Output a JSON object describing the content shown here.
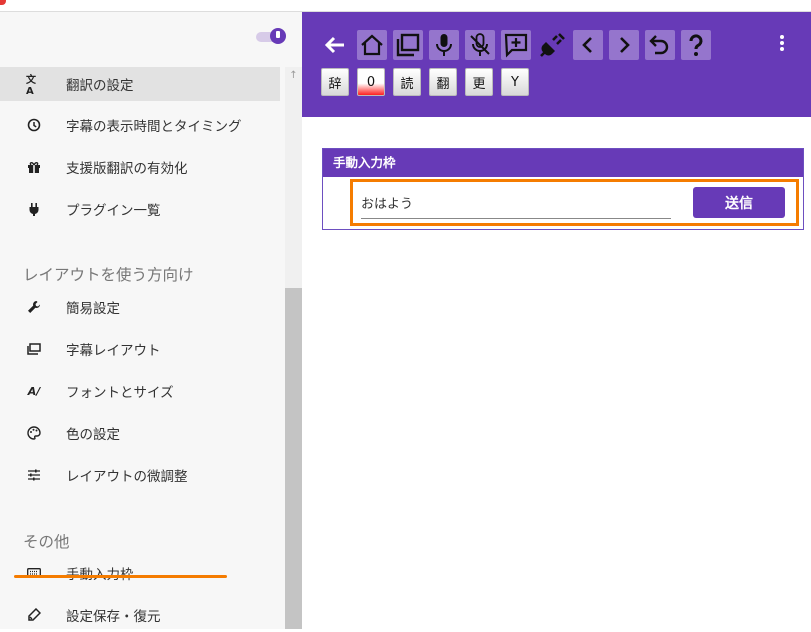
{
  "sidebar": {
    "items_top": [
      {
        "label": "翻訳の設定",
        "icon": "translate-icon",
        "active": true
      },
      {
        "label": "字幕の表示時間とタイミング",
        "icon": "clock-icon"
      },
      {
        "label": "支援版翻訳の有効化",
        "icon": "gift-icon"
      },
      {
        "label": "プラグイン一覧",
        "icon": "plug-icon"
      }
    ],
    "section_layout": "レイアウトを使う方向け",
    "items_layout": [
      {
        "label": "簡易設定",
        "icon": "wrench-icon"
      },
      {
        "label": "字幕レイアウト",
        "icon": "layout-icon"
      },
      {
        "label": "フォントとサイズ",
        "icon": "font-icon"
      },
      {
        "label": "色の設定",
        "icon": "palette-icon"
      },
      {
        "label": "レイアウトの微調整",
        "icon": "tune-icon"
      }
    ],
    "section_other": "その他",
    "items_other": [
      {
        "label": "手動入力枠",
        "icon": "keyboard-icon"
      },
      {
        "label": "設定保存・復元",
        "icon": "save-restore-icon"
      }
    ]
  },
  "toolbar": {
    "icons": [
      "back-arrow-icon",
      "home-icon",
      "window-icon",
      "mic-icon",
      "mic-off-icon",
      "add-comment-icon",
      "plug-off-icon",
      "chevron-left-icon",
      "chevron-right-icon",
      "undo-icon",
      "help-icon"
    ],
    "chips": [
      "辞",
      "0",
      "読",
      "翻",
      "更",
      "Y"
    ]
  },
  "manual_input": {
    "title": "手動入力枠",
    "value": "おはよう",
    "send_label": "送信"
  },
  "colors": {
    "primary": "#673ab7",
    "accent": "#f57c00"
  }
}
